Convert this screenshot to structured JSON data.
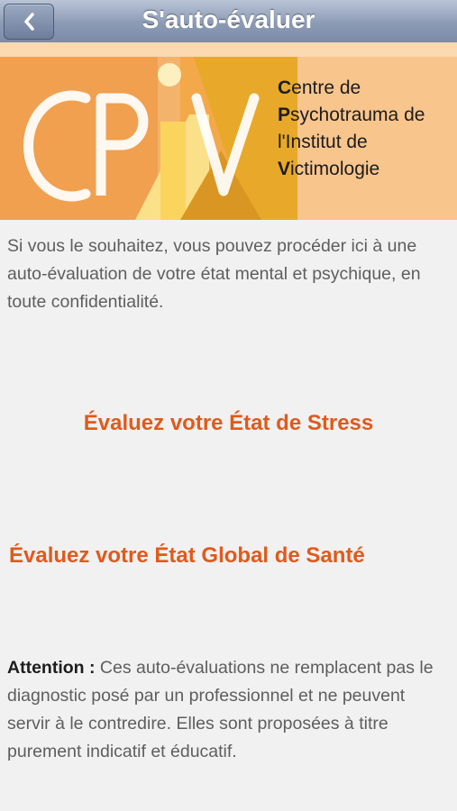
{
  "navbar": {
    "title": "S'auto-évaluer",
    "back_icon": "chevron-left-icon"
  },
  "logo": {
    "initials": "CPiV",
    "lines": [
      {
        "cap": "C",
        "rest": "entre de"
      },
      {
        "cap": "P",
        "rest": "sychotrauma de"
      },
      {
        "cap": "l'I",
        "rest": "nstitut de"
      },
      {
        "cap": "V",
        "rest": "ictimologie"
      }
    ],
    "colors": {
      "orange": "#f0a04f",
      "light_orange": "#f8c58d",
      "yellow": "#fbd45d",
      "gold": "#e8a92a"
    }
  },
  "content": {
    "intro": "Si vous le souhaitez, vous pouvez procéder ici à une auto-évaluation de votre état mental et psychique, en toute confidentialité.",
    "link_stress": "Évaluez votre État de Stress",
    "link_sante": "Évaluez votre État Global de Santé",
    "warning_label": "Attention :",
    "warning_text": " Ces auto-évaluations ne remplacent pas le diagnostic posé par un professionnel et ne peuvent servir à le contredire. Elles sont proposées à titre purement indicatif et éducatif."
  },
  "colors": {
    "link": "#e05a1c",
    "navbar": "#8c9bb5",
    "background": "#f1f1f1"
  }
}
